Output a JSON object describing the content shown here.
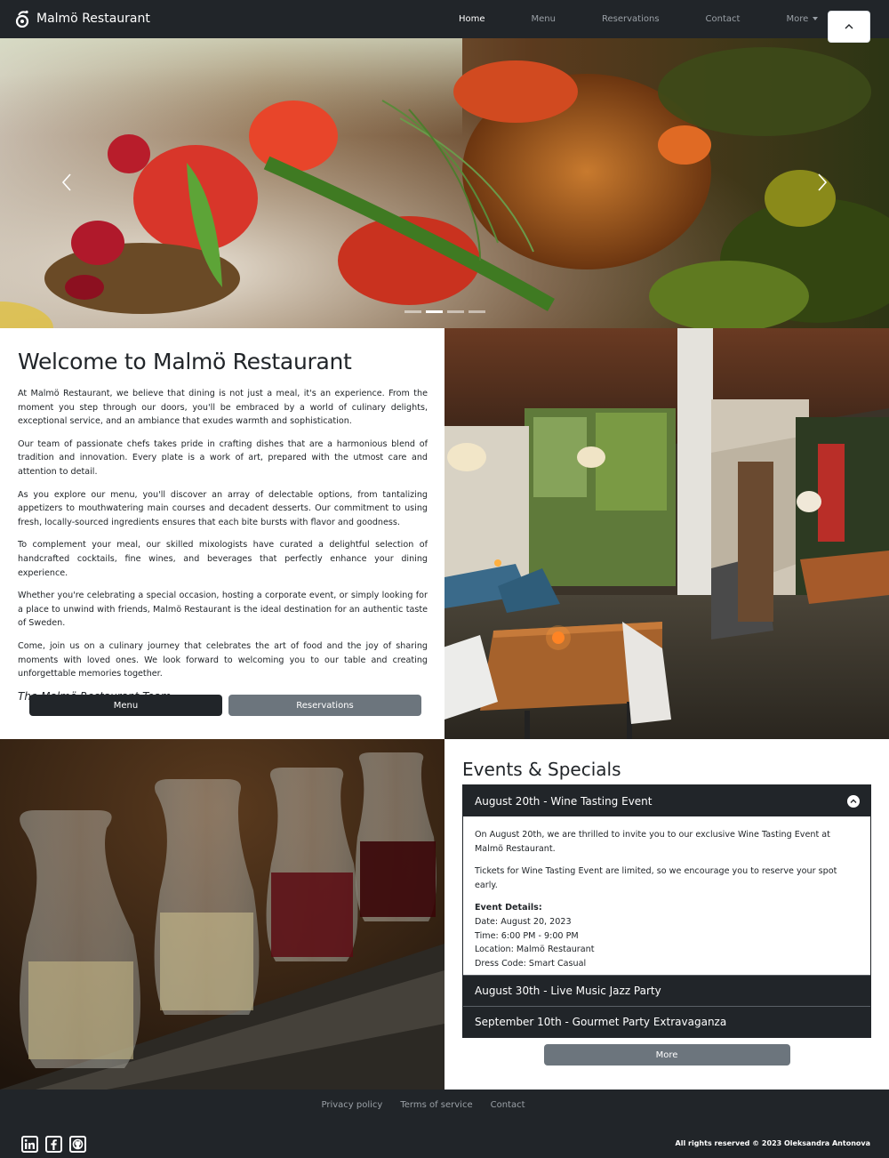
{
  "navbar": {
    "brand": "Malmö Restaurant",
    "items": [
      {
        "label": "Home"
      },
      {
        "label": "Menu"
      },
      {
        "label": "Reservations"
      },
      {
        "label": "Contact"
      },
      {
        "label": "More"
      }
    ]
  },
  "carousel": {
    "slide_count": 4,
    "active_index": 1
  },
  "welcome": {
    "title": "Welcome to Malmö Restaurant",
    "paragraphs": [
      "At Malmö Restaurant, we believe that dining is not just a meal, it's an experience. From the moment you step through our doors, you'll be embraced by a world of culinary delights, exceptional service, and an ambiance that exudes warmth and sophistication.",
      "Our team of passionate chefs takes pride in crafting dishes that are a harmonious blend of tradition and innovation. Every plate is a work of art, prepared with the utmost care and attention to detail.",
      "As you explore our menu, you'll discover an array of delectable options, from tantalizing appetizers to mouthwatering main courses and decadent desserts. Our commitment to using fresh, locally-sourced ingredients ensures that each bite bursts with flavor and goodness.",
      "To complement your meal, our skilled mixologists have curated a delightful selection of handcrafted cocktails, fine wines, and beverages that perfectly enhance your dining experience.",
      "Whether you're celebrating a special occasion, hosting a corporate event, or simply looking for a place to unwind with friends, Malmö Restaurant is the ideal destination for an authentic taste of Sweden.",
      "Come, join us on a culinary journey that celebrates the art of food and the joy of sharing moments with loved ones. We look forward to welcoming you to our table and creating unforgettable memories together."
    ],
    "signature": "The Malmö Restaurant Team",
    "menu_button": "Menu",
    "reservations_button": "Reservations"
  },
  "events": {
    "title": "Events & Specials",
    "items": [
      {
        "title": "August 20th - Wine Tasting Event",
        "expanded": true,
        "intro": "On August 20th, we are thrilled to invite you to our exclusive Wine Tasting Event at Malmö Restaurant.",
        "note": "Tickets for Wine Tasting Event are limited, so we encourage you to reserve your spot early.",
        "details_title": "Event Details:",
        "details": [
          "Date: August 20, 2023",
          "Time: 6:00 PM - 9:00 PM",
          "Location: Malmö Restaurant",
          "Dress Code: Smart Casual"
        ]
      },
      {
        "title": "August 30th - Live Music Jazz Party",
        "expanded": false
      },
      {
        "title": "September 10th - Gourmet Party Extravaganza",
        "expanded": false
      }
    ],
    "more_button": "More"
  },
  "footer": {
    "links": [
      "Privacy policy",
      "Terms of service",
      "Contact"
    ],
    "socials": [
      "linkedin-icon",
      "facebook-icon",
      "github-icon"
    ],
    "copyright": "All rights reserved © 2023 Oleksandra Antonova"
  },
  "colors": {
    "navbar_bg": "#212529",
    "btn_dark": "#212529",
    "btn_gray": "#6c757d",
    "footer_link": "#9aa0a6"
  }
}
